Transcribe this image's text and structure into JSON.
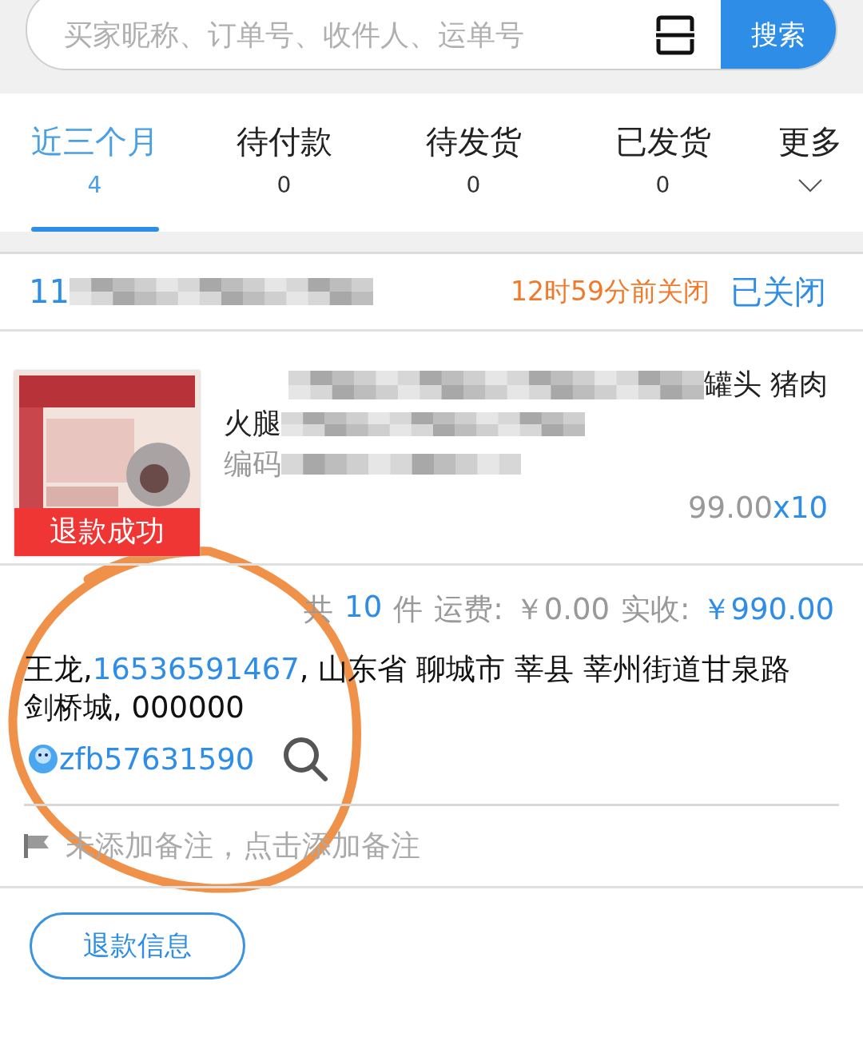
{
  "search": {
    "placeholder": "买家昵称、订单号、收件人、运单号",
    "button": "搜索"
  },
  "tabs": [
    {
      "label": "近三个月",
      "kind": "count",
      "count": "4",
      "selected": true
    },
    {
      "label": "待付款",
      "kind": "count",
      "count": "0",
      "selected": false
    },
    {
      "label": "待发货",
      "kind": "count",
      "count": "0",
      "selected": false
    },
    {
      "label": "已发货",
      "kind": "count",
      "count": "0",
      "selected": false
    },
    {
      "label": "更多",
      "kind": "more",
      "selected": false
    }
  ],
  "order": {
    "number": "11",
    "countdown": "12时59分前关闭",
    "status": "已关闭",
    "product": {
      "title_line1": "罐头 猪肉",
      "title_line2": "火腿",
      "code_label": "编码",
      "price": "99.00",
      "quantity": "x10",
      "badge": "退款成功"
    },
    "summary": [
      {
        "text": "共",
        "highlight": false
      },
      {
        "text": "10",
        "highlight": true
      },
      {
        "text": "件",
        "highlight": false
      },
      {
        "text": "运费:",
        "highlight": false
      },
      {
        "text": "￥0.00",
        "highlight": false
      },
      {
        "text": "实收:",
        "highlight": false
      },
      {
        "text": "￥990.00",
        "highlight": true
      }
    ],
    "address": {
      "name": "王龙,",
      "phone": "16536591467",
      "rest": ", 山东省 聊城市 莘县 莘州街道甘泉路剑桥城, 000000"
    },
    "buyer": "zfb57631590",
    "note": "未添加备注，点击添加备注",
    "button": "退款信息"
  }
}
